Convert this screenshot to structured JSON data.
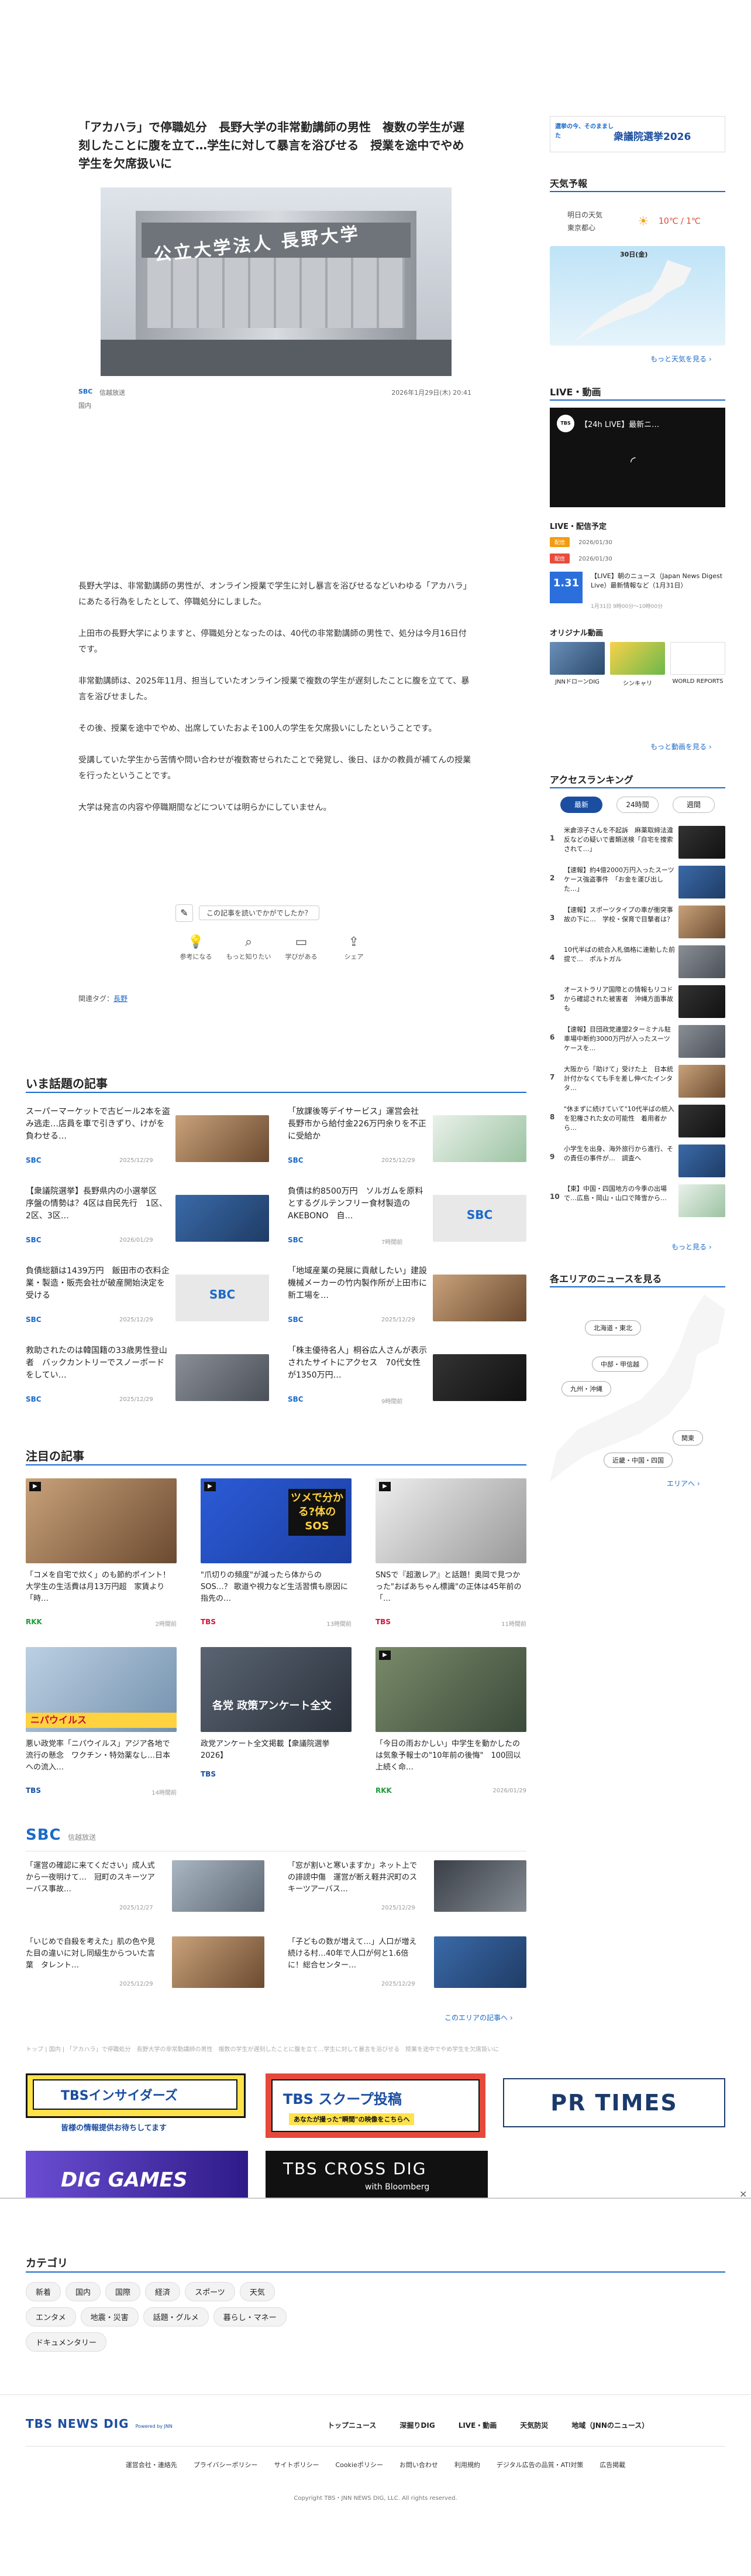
{
  "article": {
    "title": "「アカハラ」で停職処分　長野大学の非常勤講師の男性　複数の学生が遅刻したことに腹を立て…学生に対して暴言を浴びせる　授業を途中でやめ学生を欠席扱いに",
    "photo_sign": "公立大学法人 長野大学",
    "source": "信越放送",
    "category": "国内",
    "datetime": "2026年1月29日(木) 20:41",
    "body": [
      "長野大学は、非常勤講師の男性が、オンライン授業で学生に対し暴言を浴びせるなどいわゆる「アカハラ」にあたる行為をしたとして、停職処分にしました。",
      "上田市の長野大学によりますと、停職処分となったのは、40代の非常勤講師の男性で、処分は今月16日付です。",
      "非常勤講師は、2025年11月、担当していたオンライン授業で複数の学生が遅刻したことに腹を立てて、暴言を浴びせました。",
      "その後、授業を途中でやめ、出席していたおよそ100人の学生を欠席扱いにしたということです。",
      "受講していた学生から苦情や問い合わせが複数寄せられたことで発覚し、後日、ほかの教員が補てんの授業を行ったということです。",
      "大学は発言の内容や停職期間などについては明らかにしていません。"
    ],
    "feedback_question": "この記事を読いでかがでしたか？",
    "reactions": [
      "参考になる",
      "もっと知りたい",
      "学びがある",
      "シェア"
    ],
    "tags_label": "関連タグ：",
    "tag": "長野"
  },
  "trending": {
    "title": "いま話題の記事",
    "items": [
      {
        "text": "スーパーマーケットで古ビール2本を盗み逃走…店員を車で引きずり、けがを負わせる…",
        "source": "SBC",
        "date": "2025/12/29"
      },
      {
        "text": "「放課後等デイサービス」運営会社　長野市から給付金226万円余りを不正に受給か",
        "source": "SBC",
        "date": "2025/12/29"
      },
      {
        "text": "【衆議院選挙】長野県内の小選挙区　序盤の情勢は？4区は自民先行　1区、2区、3区…",
        "source": "SBC",
        "date": "2026/01/29"
      },
      {
        "text": "負債は約8500万円　ソルガムを原料とするグルテンフリー食材製造のAKEBONO　自…",
        "source": "SBC",
        "date": "7時間前"
      },
      {
        "text": "負債総額は1439万円　飯田市の衣料企業・製造・販売会社が破産開始決定を受ける",
        "source": "SBC",
        "date": "2025/12/29"
      },
      {
        "text": "「地域産業の発展に貢献したい」建設機械メーカーの竹内製作所が上田市に新工場を…",
        "source": "SBC",
        "date": "2025/12/29"
      },
      {
        "text": "救助されたのは韓国籍の33歳男性登山者　バックカントリーでスノーボードをしてい…",
        "source": "SBC",
        "date": "2025/12/29"
      },
      {
        "text": "「株主優待名人」桐谷広人さんが表示されたサイトにアクセス　70代女性が1350万円…",
        "source": "SBC",
        "date": "9時間前"
      }
    ]
  },
  "featured": {
    "title": "注目の記事",
    "items": [
      {
        "text": "「コメを自宅で炊く」のも節約ポイント！　大学生の生活費は月13万円超　家賃より「時…",
        "source": "RKK",
        "date": "2時間前"
      },
      {
        "text": "\"爪切りの頻度\"が減ったら体からのSOS…？ 歌道や視力など生活習慣も原因に　指先の…",
        "source": "TBS",
        "date": "13時間前"
      },
      {
        "text": "SNSで『超激レア』と話題！奥岡で見つかった\"おばあちゃん標識\"の正体は45年前の「…",
        "source": "TBS",
        "date": "11時間前"
      },
      {
        "text": "悪い政党率「ニパウイルス」アジア各地で流行の懸念　ワクチン・特効薬なし…日本への流入…",
        "source": "TBS",
        "date": "14時間前"
      },
      {
        "text": "政党アンケート全文掲載【衆議院選挙2026】",
        "source": "TBS",
        "date": ""
      },
      {
        "text": "「今日の雨おかしい」中学生を動かしたのは気象予報士の\"10年前の後悔\"　100回以上続く命…",
        "source": "RKK",
        "date": "2026/01/29"
      }
    ],
    "thumb_labels": [
      "ツメで分かる?体のSOS",
      "各党 政策アンケート全文",
      "ニパウイルス"
    ]
  },
  "sbc_section": {
    "logo": "SBC",
    "name": "信越放送",
    "items": [
      {
        "text": "「運営の確認に来てください」成人式から一夜明けて…　冠町のスキーツアーバス事故…",
        "date": "2025/12/27"
      },
      {
        "text": "「窓が割いと寒いますか」ネット上での誹謗中傷　運営が断え軽井沢町のスキーツアーバス…",
        "date": "2025/12/29"
      },
      {
        "text": "「いじめで自殺を考えた」肌の色や見た目の違いに対し同級生からついた言葉　タレント…",
        "date": "2025/12/29"
      },
      {
        "text": "「子どもの数が増えて…」人口が増え続ける村…40年で人口が何と1.6倍に！総合センター…",
        "date": "2025/12/29"
      }
    ],
    "more": "このエリアの記事へ ›"
  },
  "breadcrumb": "トップ | 国内 | 「アカハラ」で停職処分　長野大学の非常勤講師の男性　複数の学生が遅刻したことに腹を立て…学生に対して暴言を浴びせる　授業を途中でやめ学生を欠席扱いに",
  "banners": {
    "insiders": "TBSインサイダーズ",
    "insiders_sub": "皆様の情報提供お待ちしてます",
    "scoop": "TBS スクープ投稿",
    "scoop_sub": "あなたが撮った\"瞬間\"の映像をこちらへ",
    "prtimes": "PR TIMES",
    "digigames": "DIG GAMES",
    "crossdig": "TBS CROSS DIG",
    "crossdig_sub": "with Bloomberg"
  },
  "categories": {
    "title": "カテゴリ",
    "items": [
      "新着",
      "国内",
      "国際",
      "経済",
      "スポーツ",
      "天気",
      "エンタメ",
      "地震・災害",
      "話題・グルメ",
      "暮らし・マネー",
      "ドキュメンタリー"
    ]
  },
  "footer": {
    "logo": "TBS NEWS DIG",
    "logo_sub": "Powered by JNN",
    "nav": [
      "トップニュース",
      "深掘りDIG",
      "LIVE・動画",
      "天気防災",
      "地域（JNNのニュース）"
    ],
    "links": [
      "運営会社・連絡先",
      "プライバシーポリシー",
      "サイトポリシー",
      "Cookieポリシー",
      "お問い合わせ",
      "利用規約",
      "デジタル広告の品質・ATI対策",
      "広告掲載"
    ],
    "copyright": "Copyright TBS・JNN NEWS DIG, LLC. All rights reserved."
  },
  "sidebar": {
    "election_banner": {
      "left": "選挙の今、そのまました",
      "right": "衆議院選挙2026"
    },
    "weather": {
      "title": "天気予報",
      "area_label": "明日の天気",
      "area": "東京都心",
      "temp": "10℃ / 1℃",
      "date": "30日(金)",
      "more": "もっと天気を見る ›"
    },
    "live": {
      "title": "LIVE・動画",
      "player_title": "【24h LIVE】最新ニ…",
      "schedule_title": "LIVE・配信予定",
      "schedule": [
        {
          "badge": "配信",
          "text": "2026/01/30"
        },
        {
          "badge": "配信",
          "text": "2026/01/30"
        }
      ],
      "date_badge": "1.31",
      "video_text": "【LIVE】朝のニュース（Japan News Digest Live）最新情報など（1月31日）",
      "video_date": "1月31日 9時00分～10時00分",
      "original_title": "オリジナル動画",
      "originals": [
        "JNNドローンDIG",
        "シンキャリ",
        "WORLD REPORTS"
      ],
      "more": "もっと動画を見る ›"
    },
    "ranking": {
      "title": "アクセスランキング",
      "tabs": [
        "最新",
        "24時間",
        "週間"
      ],
      "items": [
        "米倉涼子さんを不起訴　麻薬取締法違反などの疑いで書類送検「自宅を捜索されて…」",
        "【速報】約4億2000万円入ったスーツケース強盗事件　「お金を運び出した…」",
        "【速報】スポーツタイプの車が衝突事故の下に…　学校・保育で目撃者は？",
        "10代半ばの統合入札価格に連動した前提で…　ポルトガル",
        "オーストラリア国際との情報もリコドから確認された被害者　沖縄方面事故も",
        "【速報】目団政党連盟2ターミナル駐車場中断約3000万円が入ったスーツケースを…",
        "大阪から「助けて」受けた上　日本統計付かなくても手を差し伸べたインタタ…",
        "\"休まずに続けていて\"10代半ばの統入を犯権された女の可能性　着用者から…",
        "小学生を出身、海外旅行から進行、その責任の事件が…　調査へ",
        "【東】中国・四国地方の今季の出場で…広島・岡山・山口で降雪から…"
      ],
      "more": "もっと見る ›"
    },
    "areas": {
      "title": "各エリアのニュースを見る",
      "regions": [
        "北海道・東北",
        "中部・甲信越",
        "九州・沖縄",
        "関東",
        "近畿・中国・四国"
      ],
      "more": "エリアへ ›"
    }
  }
}
